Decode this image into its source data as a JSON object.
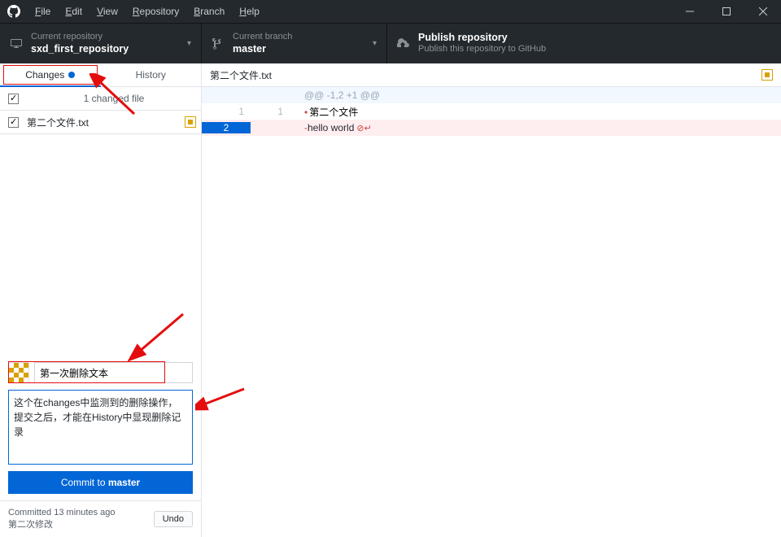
{
  "menu": {
    "file": "File",
    "edit": "Edit",
    "view": "View",
    "repository": "Repository",
    "branch": "Branch",
    "help": "Help"
  },
  "toolbar": {
    "repo_label": "Current repository",
    "repo_name": "sxd_first_repository",
    "branch_label": "Current branch",
    "branch_name": "master",
    "publish_title": "Publish repository",
    "publish_sub": "Publish this repository to GitHub"
  },
  "tabs": {
    "changes": "Changes",
    "history": "History"
  },
  "changes": {
    "count_label": "1 changed file",
    "files": [
      {
        "name": "第二个文件.txt"
      }
    ]
  },
  "commit": {
    "summary": "第一次删除文本",
    "description": "这个在changes中监测到的删除操作，提交之后，才能在History中显现删除记录",
    "button_prefix": "Commit to ",
    "button_branch": "master"
  },
  "last_commit": {
    "time": "Committed 13 minutes ago",
    "message": "第二次修改",
    "undo": "Undo"
  },
  "diff": {
    "filename": "第二个文件.txt",
    "hunk": "@@ -1,2 +1 @@",
    "lines": [
      {
        "o": "1",
        "n": "1",
        "type": "ctx",
        "text": "第二个文件"
      },
      {
        "o": "2",
        "n": "",
        "type": "del",
        "text": "hello world"
      }
    ]
  }
}
